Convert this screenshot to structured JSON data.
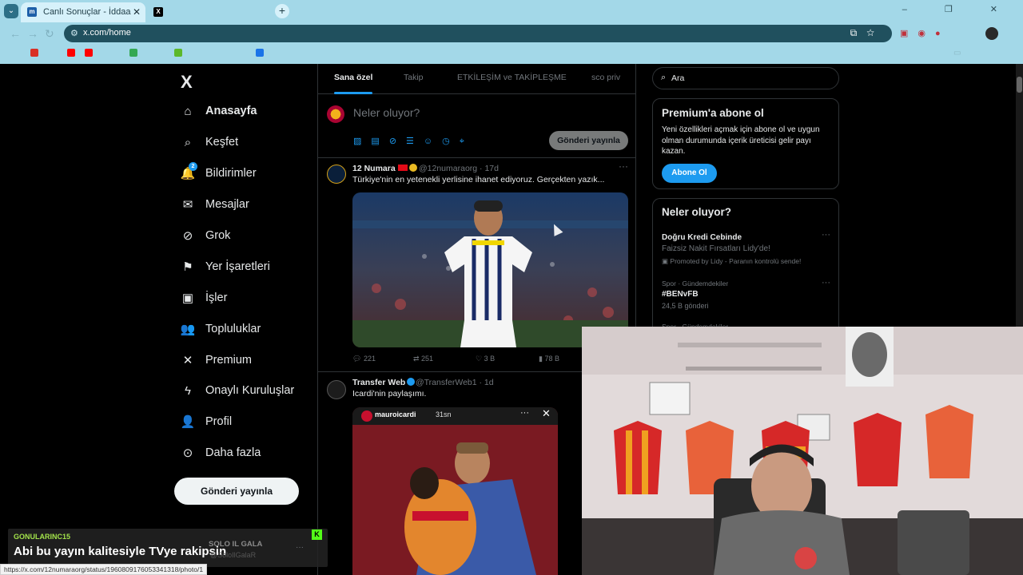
{
  "browser": {
    "tabs": [
      {
        "title": "Canlı Sonuçlar - İddaa Sonuçları",
        "favicon": "m",
        "active": true
      },
      {
        "title": "",
        "favicon": "X",
        "active": false
      }
    ],
    "new_tab_symbol": "+",
    "window_controls": "‒ ❐ ✕",
    "url": "x.com/home",
    "bookmarks": [
      {
        "label": "",
        "color": "#d93025"
      },
      {
        "label": "",
        "color": "#ff0000"
      },
      {
        "label": "",
        "color": "#ff0000"
      },
      {
        "label": "",
        "color": "#34a853"
      },
      {
        "label": "",
        "color": "#5cb82a"
      },
      {
        "label": "",
        "color": "#1a73e8"
      }
    ]
  },
  "sidebar": {
    "logo": "X",
    "items": [
      {
        "label": "Anasayfa",
        "icon": "home-icon",
        "glyph": "⌂",
        "bold": true
      },
      {
        "label": "Keşfet",
        "icon": "search-icon",
        "glyph": "⌕"
      },
      {
        "label": "Bildirimler",
        "icon": "bell-icon",
        "glyph": "🔔",
        "badge": "2"
      },
      {
        "label": "Mesajlar",
        "icon": "envelope-icon",
        "glyph": "✉"
      },
      {
        "label": "Grok",
        "icon": "grok-icon",
        "glyph": "⊘"
      },
      {
        "label": "Yer İşaretleri",
        "icon": "bookmark-icon",
        "glyph": "⚑"
      },
      {
        "label": "İşler",
        "icon": "briefcase-icon",
        "glyph": "▣"
      },
      {
        "label": "Topluluklar",
        "icon": "communities-icon",
        "glyph": "👥"
      },
      {
        "label": "Premium",
        "icon": "x-premium-icon",
        "glyph": "✕"
      },
      {
        "label": "Onaylı Kuruluşlar",
        "icon": "lightning-icon",
        "glyph": "ϟ"
      },
      {
        "label": "Profil",
        "icon": "profile-icon",
        "glyph": "👤"
      },
      {
        "label": "Daha fazla",
        "icon": "more-circle-icon",
        "glyph": "⊙"
      }
    ],
    "post_button": "Gönderi yayınla"
  },
  "timeline": {
    "tabs": [
      "Sana özel",
      "Takip",
      "ETKİLEŞİM ve TAKİPLEŞME",
      "sco priv"
    ],
    "composer": {
      "placeholder": "Neler oluyor?",
      "post_button": "Gönderi yayınla",
      "icons": [
        "image-icon",
        "gif-icon",
        "grok-icon",
        "poll-icon",
        "emoji-icon",
        "schedule-icon",
        "location-icon"
      ]
    },
    "tweets": [
      {
        "name": "12 Numara",
        "handle": "@12numaraorg · 17d",
        "text": "Türkiye'nin en yetenekli yerlisine ihanet ediyoruz. Gerçekten yazık...",
        "replies": "221",
        "retweets": "251",
        "likes": "3 B",
        "views": "78 B"
      },
      {
        "name": "Transfer Web",
        "handle": "@TransferWeb1 · 1d",
        "text": "Icardi'nin paylaşımı.",
        "embed_user": "mauroicardi",
        "embed_time": "31sn"
      }
    ]
  },
  "right": {
    "search_placeholder": "Ara",
    "premium": {
      "title": "Premium'a abone ol",
      "desc": "Yeni özellikleri açmak için abone ol ve uygun olman durumunda içerik üreticisi gelir payı kazan.",
      "button": "Abone Ol"
    },
    "trends": {
      "title": "Neler oluyor?",
      "items": [
        {
          "title": "Doğru Kredi Cebinde",
          "sub": "Faizsiz Nakit Fırsatları Lidy'de!",
          "meta": "Promoted by Lidy - Paranın kontrolü sende!"
        },
        {
          "meta": "Spor · Gündemdekiler",
          "title": "#BENvFB",
          "sub": "24,5 B gönderi"
        },
        {
          "meta": "Spor · Gündemdekiler"
        }
      ]
    }
  },
  "chat": {
    "username": "GONULARINC15",
    "message": "Abi bu yayın kalitesiyle TVye rakipsin",
    "platform": "K",
    "solo_name": "SOLO IL GALA",
    "solo_handle": "@SoloIlGalaR"
  },
  "status_url": "https://x.com/12numaraorg/status/1960809176053341318/photo/1",
  "colors": {
    "accent": "#1d9bf0",
    "background": "#000000",
    "chrome": "#a3d8e8"
  }
}
